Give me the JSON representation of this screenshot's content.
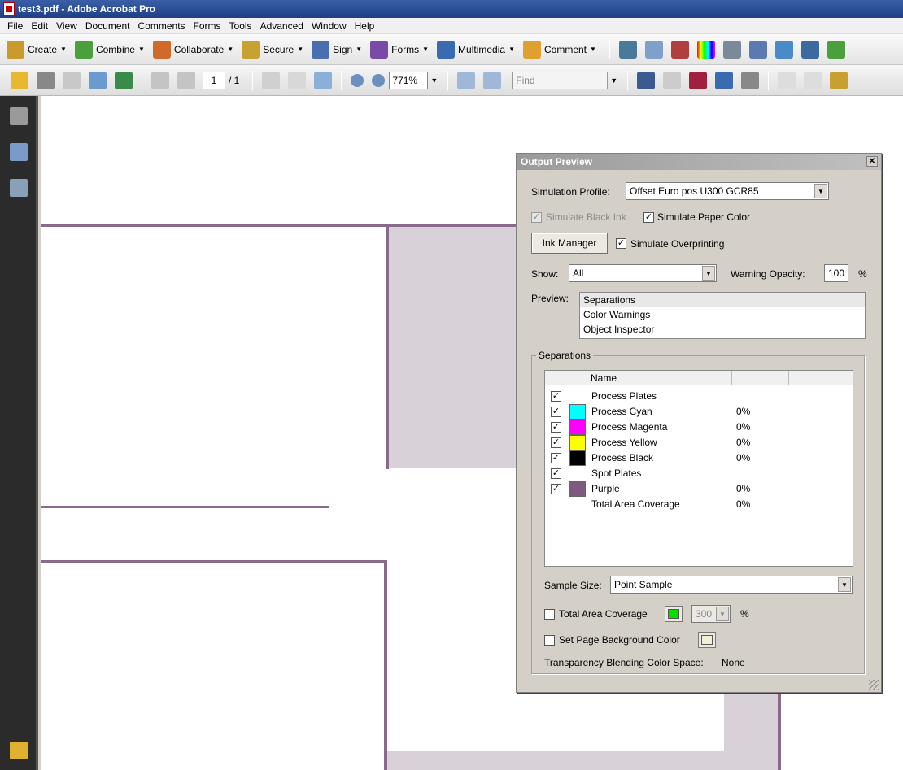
{
  "window": {
    "title": "test3.pdf - Adobe Acrobat Pro"
  },
  "menu": [
    "File",
    "Edit",
    "View",
    "Document",
    "Comments",
    "Forms",
    "Tools",
    "Advanced",
    "Window",
    "Help"
  ],
  "toolbar1": {
    "buttons": [
      {
        "label": "Create",
        "icon": "create-icon",
        "color": "#c99a2e"
      },
      {
        "label": "Combine",
        "icon": "combine-icon",
        "color": "#4aa03a"
      },
      {
        "label": "Collaborate",
        "icon": "collaborate-icon",
        "color": "#d06a2a"
      },
      {
        "label": "Secure",
        "icon": "lock-icon",
        "color": "#c8a230"
      },
      {
        "label": "Sign",
        "icon": "pen-icon",
        "color": "#4a6fb0"
      },
      {
        "label": "Forms",
        "icon": "forms-icon",
        "color": "#7a4aa8"
      },
      {
        "label": "Multimedia",
        "icon": "multimedia-icon",
        "color": "#3a6ab0"
      },
      {
        "label": "Comment",
        "icon": "comment-icon",
        "color": "#e0a030"
      }
    ]
  },
  "toolbar2": {
    "page_current": "1",
    "page_total": "/ 1",
    "zoom": "771%",
    "find_placeholder": "Find"
  },
  "dialog": {
    "title": "Output Preview",
    "simulation_profile_label": "Simulation Profile:",
    "simulation_profile_value": "Offset Euro pos U300 GCR85",
    "simulate_black_ink": "Simulate Black Ink",
    "simulate_paper_color": "Simulate Paper Color",
    "ink_manager": "Ink Manager",
    "simulate_overprinting": "Simulate Overprinting",
    "show_label": "Show:",
    "show_value": "All",
    "warning_opacity_label": "Warning Opacity:",
    "warning_opacity_value": "100",
    "percent": "%",
    "preview_label": "Preview:",
    "preview_options": [
      "Separations",
      "Color Warnings",
      "Object Inspector"
    ],
    "separations_group": "Separations",
    "table_header_name": "Name",
    "separations": [
      {
        "name": "Process Plates",
        "checked": true,
        "swatch": null,
        "pct": ""
      },
      {
        "name": "Process Cyan",
        "checked": true,
        "swatch": "#00ffff",
        "pct": "0%"
      },
      {
        "name": "Process Magenta",
        "checked": true,
        "swatch": "#ff00ff",
        "pct": "0%"
      },
      {
        "name": "Process Yellow",
        "checked": true,
        "swatch": "#ffff00",
        "pct": "0%"
      },
      {
        "name": "Process Black",
        "checked": true,
        "swatch": "#000000",
        "pct": "0%"
      },
      {
        "name": "Spot Plates",
        "checked": true,
        "swatch": null,
        "pct": ""
      },
      {
        "name": "Purple",
        "checked": true,
        "swatch": "#7d5a80",
        "pct": "0%"
      },
      {
        "name": "Total Area Coverage",
        "checked": false,
        "swatch": null,
        "pct": "0%"
      }
    ],
    "sample_size_label": "Sample Size:",
    "sample_size_value": "Point Sample",
    "total_area_coverage": "Total Area Coverage",
    "tac_value": "300",
    "tac_color": "#00e000",
    "set_page_background": "Set Page Background Color",
    "page_bg_color": "#f2efd8",
    "transparency_label": "Transparency Blending Color Space:",
    "transparency_value": "None"
  }
}
